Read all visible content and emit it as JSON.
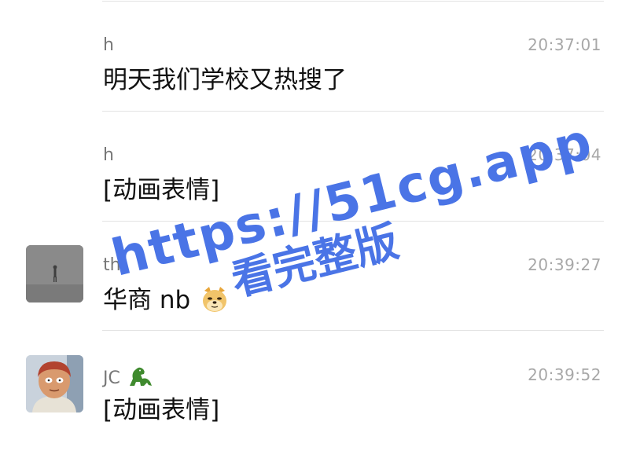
{
  "messages": [
    {
      "sender": "h",
      "time": "20:37:01",
      "text": "明天我们学校又热搜了",
      "avatar": null
    },
    {
      "sender": "h",
      "time": "20:37:04",
      "text": "[动画表情]",
      "avatar": null
    },
    {
      "sender": "th",
      "time": "20:39:27",
      "text": "华商 nb",
      "avatar": "gray-figure-avatar",
      "emoji": "doge-emoji"
    },
    {
      "sender": "JC",
      "time": "20:39:52",
      "text": "[动画表情]",
      "avatar": "cartoon-character-avatar",
      "sender_emoji": "dinosaur-emoji"
    }
  ],
  "watermark": {
    "line1": "https://51cg.app",
    "line2": "看完整版",
    "color": "#4a74e6"
  }
}
